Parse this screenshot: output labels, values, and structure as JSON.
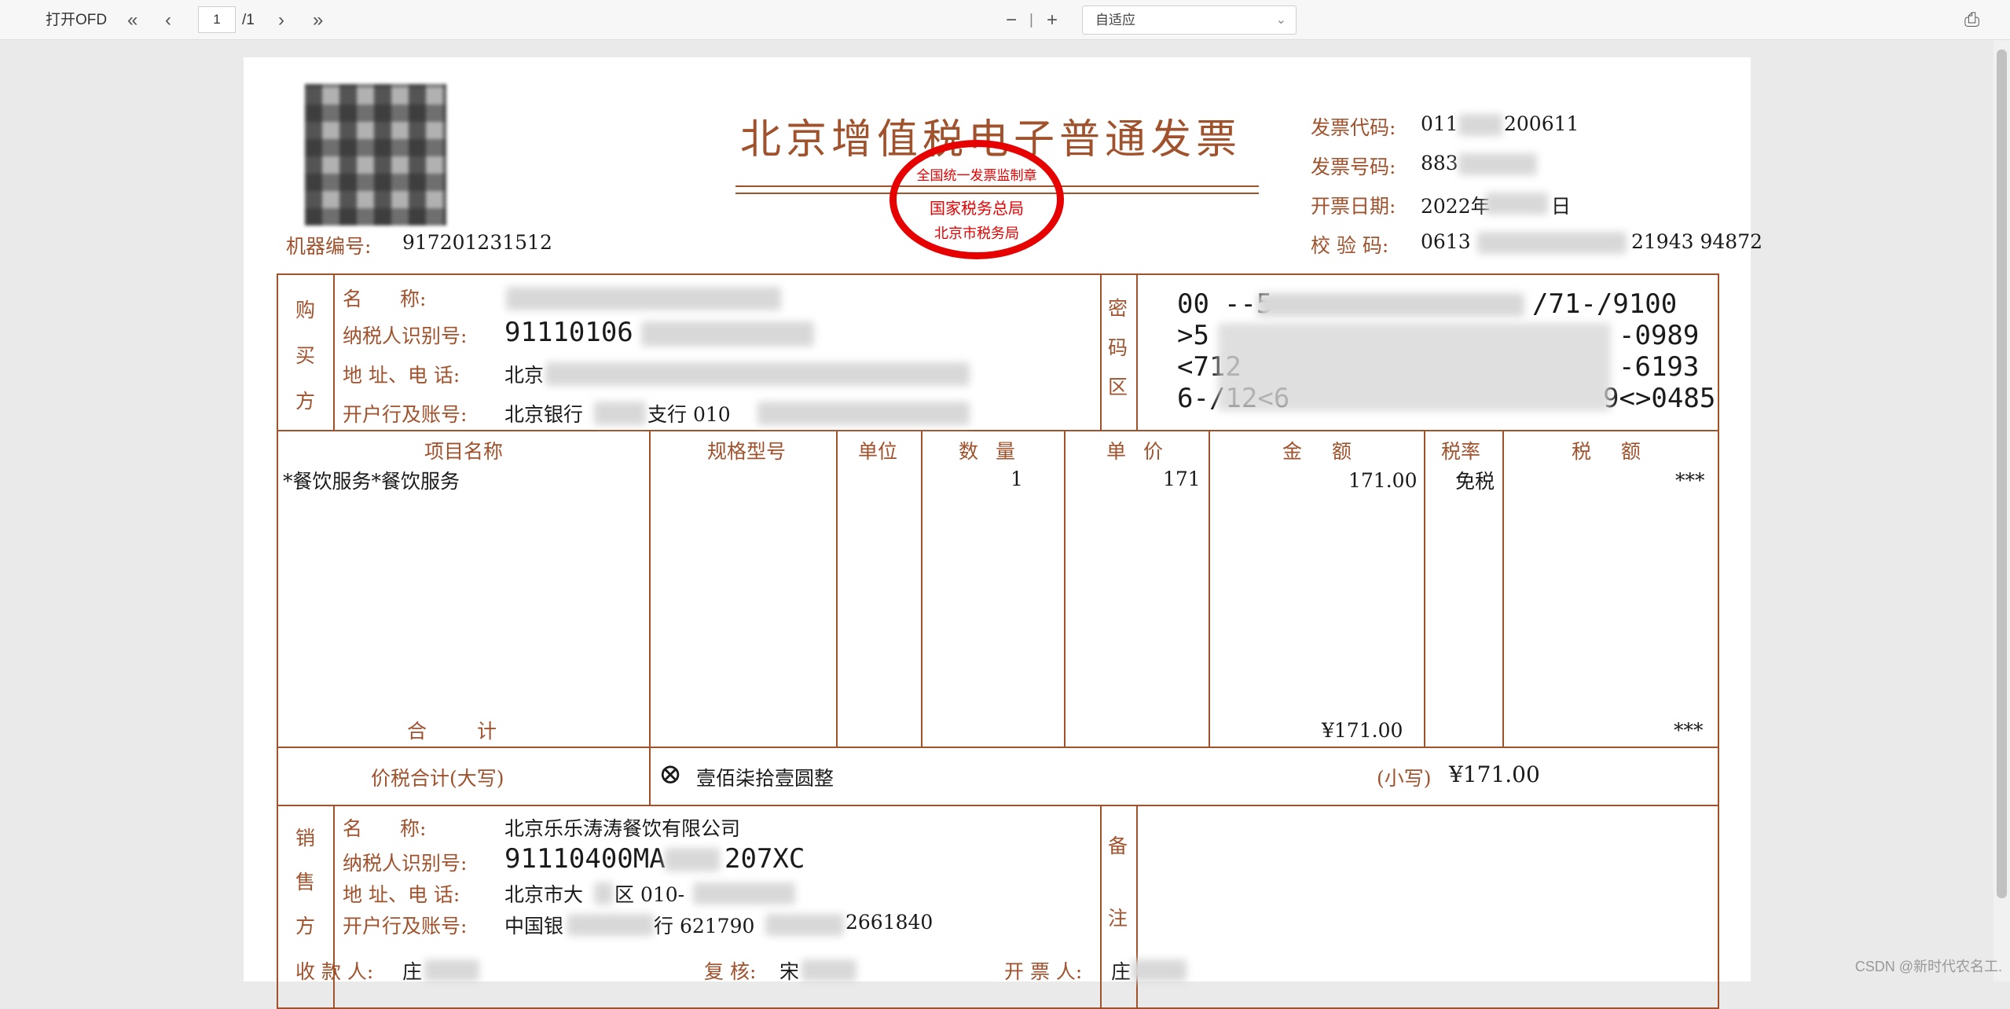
{
  "toolbar": {
    "open_label": "打开OFD",
    "first_icon": "«",
    "prev_icon": "‹",
    "page_value": "1",
    "page_total": "/1",
    "next_icon": "›",
    "last_icon": "»",
    "zoom_out": "−",
    "zoom_sep": "|",
    "zoom_in": "+",
    "zoom_mode": "自适应",
    "print_icon": "⎙"
  },
  "invoice": {
    "title": "北京增值税电子普通发票",
    "machine_no_label": "机器编号:",
    "machine_no": "917201231512",
    "code_label": "发票代码:",
    "code_value": "011",
    "code_value2": "200611",
    "number_label": "发票号码:",
    "number_value": "883",
    "date_label": "开票日期:",
    "date_value": "2022年",
    "date_value2": "日",
    "check_label": "校 验 码:",
    "check_value": "0613",
    "check_value2": "21943 94872",
    "stamp_top": "全国统一发票监制章",
    "stamp_mid": "国家税务总局",
    "stamp_bottom": "北京市税务局",
    "buyer": {
      "side_1": "购",
      "side_2": "买",
      "side_3": "方",
      "name_label": "名 称:",
      "taxid_label": "纳税人识别号:",
      "taxid_value": "91110106",
      "addr_label": "地 址、电 话:",
      "addr_value": "北京",
      "bank_label": "开户行及账号:",
      "bank_value": "北京银行",
      "bank_value2": "支行 010"
    },
    "cipher": {
      "label_1": "密",
      "label_2": "码",
      "label_3": "区",
      "line1a": "00",
      "line1b": "--5-",
      "line1c": "/71-/9100",
      "line2a": ">5",
      "line2b": "-0989",
      "line3a": "<712",
      "line3b": "-6193",
      "line4a": "6-/12<6",
      "line4b": "9<>0485"
    },
    "headers": {
      "item": "项目名称",
      "spec": "规格型号",
      "unit": "单位",
      "qty": "数 量",
      "price": "单 价",
      "amount": "金 额",
      "rate": "税率",
      "tax": "税 额"
    },
    "row": {
      "item": "*餐饮服务*餐饮服务",
      "qty": "1",
      "price": "171",
      "amount": "171.00",
      "rate": "免税",
      "tax": "***"
    },
    "total_label": "合 计",
    "total_amount": "¥171.00",
    "total_tax": "***",
    "pricetax_label": "价税合计(大写)",
    "pricetax_upper": "壹佰柒拾壹圆整",
    "pricetax_small_label": "(小写)",
    "pricetax_small": "¥171.00",
    "seller": {
      "side_1": "销",
      "side_2": "售",
      "side_3": "方",
      "name_label": "名 称:",
      "name_value": "北京乐乐涛涛餐饮有限公司",
      "taxid_label": "纳税人识别号:",
      "taxid_value": "91110400MA",
      "taxid_value2": "207XC",
      "addr_label": "地 址、电 话:",
      "addr_value": "北京市大",
      "addr_value2": "区 010-",
      "bank_label": "开户行及账号:",
      "bank_value": "中国银",
      "bank_value2": "行 621790",
      "bank_value3": "2661840"
    },
    "remark_1": "备",
    "remark_2": "注",
    "payee_label": "收 款 人:",
    "payee_value": "庄",
    "reviewer_label": "复 核:",
    "reviewer_value": "宋",
    "drawer_label": "开 票 人:",
    "drawer_value": "庄"
  },
  "watermark": "CSDN @新时代农名工."
}
